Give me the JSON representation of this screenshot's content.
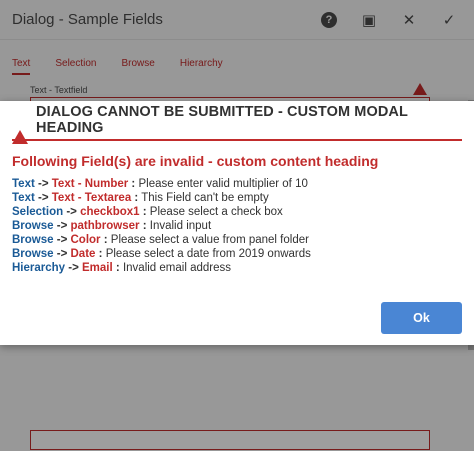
{
  "dialog": {
    "title": "Dialog - Sample Fields",
    "help_label": "?",
    "fullscreen_label": "▣",
    "close_label": "✕",
    "done_label": "✓",
    "tabs": [
      {
        "label": "Text"
      },
      {
        "label": "Selection"
      },
      {
        "label": "Browse"
      },
      {
        "label": "Hierarchy"
      }
    ],
    "field_label": "Text - Textfield"
  },
  "modal": {
    "heading": "DIALOG CANNOT BE SUBMITTED - CUSTOM MODAL HEADING",
    "content_heading": "Following Field(s) are invalid - custom content heading",
    "arrow": "->",
    "colon": ":",
    "errors": [
      {
        "tab": "Text",
        "field": "Text - Number",
        "message": "Please enter valid multiplier of 10"
      },
      {
        "tab": "Text",
        "field": "Text - Textarea",
        "message": "This Field can't be empty"
      },
      {
        "tab": "Selection",
        "field": "checkbox1",
        "message": "Please select a check box"
      },
      {
        "tab": "Browse",
        "field": "pathbrowser",
        "message": "Invalid input"
      },
      {
        "tab": "Browse",
        "field": "Color",
        "message": "Please select a value from panel folder"
      },
      {
        "tab": "Browse",
        "field": "Date",
        "message": "Please select a date from 2019 onwards"
      },
      {
        "tab": "Hierarchy",
        "field": "Email",
        "message": "Invalid email address"
      }
    ],
    "ok_label": "Ok"
  },
  "colors": {
    "error_red": "#c12c2c",
    "tab_blue": "#1a5a96",
    "button_blue": "#4a86d4"
  }
}
